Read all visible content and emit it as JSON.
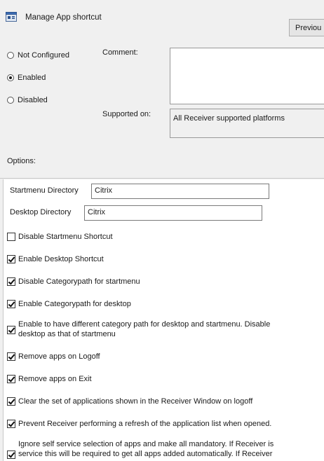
{
  "header": {
    "title": "Manage App shortcut",
    "previous_label": "Previou"
  },
  "state": {
    "options": [
      "Not Configured",
      "Enabled",
      "Disabled"
    ],
    "selected": "Enabled"
  },
  "comment": {
    "label": "Comment:",
    "value": ""
  },
  "supported": {
    "label": "Supported on:",
    "value": "All Receiver supported platforms"
  },
  "options_label": "Options:",
  "fields": {
    "startmenu_dir": {
      "label": "Startmenu Directory",
      "value": "Citrix"
    },
    "desktop_dir": {
      "label": "Desktop Directory",
      "value": "Citrix"
    }
  },
  "checkboxes": [
    {
      "lines": [
        "Disable Startmenu Shortcut"
      ],
      "checked": false
    },
    {
      "lines": [
        "Enable Desktop Shortcut"
      ],
      "checked": true
    },
    {
      "lines": [
        "Disable Categorypath for startmenu"
      ],
      "checked": true
    },
    {
      "lines": [
        "Enable Categorypath for desktop"
      ],
      "checked": true
    },
    {
      "lines": [
        "Enable to have different category path for desktop and startmenu. Disable",
        "desktop as that of startmenu"
      ],
      "checked": true
    },
    {
      "lines": [
        "Remove apps on Logoff"
      ],
      "checked": true
    },
    {
      "lines": [
        "Remove apps on Exit"
      ],
      "checked": true
    },
    {
      "lines": [
        "Clear the set of applications shown in the Receiver Window on logoff"
      ],
      "checked": true
    },
    {
      "lines": [
        "Prevent Receiver performing a refresh of the application list when opened."
      ],
      "checked": true
    },
    {
      "lines": [
        "Ignore self service selection of apps and make all mandatory. If Receiver is",
        "service this will be required to get all apps added automatically. If Receiver"
      ],
      "checked": true
    }
  ]
}
